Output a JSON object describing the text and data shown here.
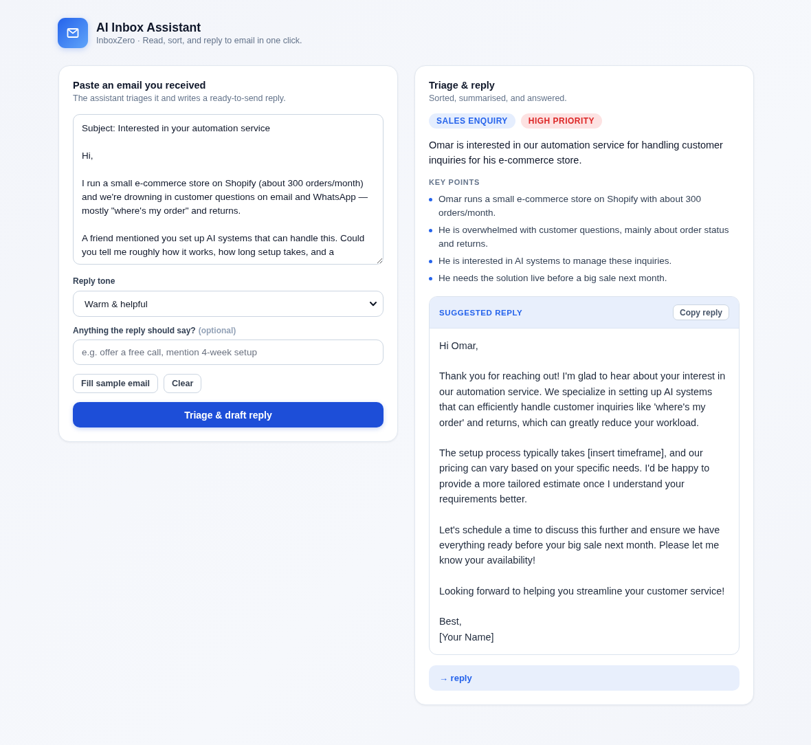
{
  "header": {
    "title": "AI Inbox Assistant",
    "subtitle": "InboxZero · Read, sort, and reply to email in one click."
  },
  "input_panel": {
    "title": "Paste an email you received",
    "subtitle": "The assistant triages it and writes a ready-to-send reply.",
    "email_text": "Subject: Interested in your automation service\n\nHi,\n\nI run a small e-commerce store on Shopify (about 300 orders/month) and we're drowning in customer questions on email and WhatsApp — mostly \"where's my order\" and returns.\n\nA friend mentioned you set up AI systems that can handle this. Could you tell me roughly how it works, how long setup takes, and a",
    "tone": {
      "label": "Reply tone",
      "value": "Warm & helpful"
    },
    "notes": {
      "label": "Anything the reply should say?",
      "hint": "(optional)",
      "placeholder": "e.g. offer a free call, mention 4-week setup"
    },
    "buttons": [
      "Fill sample email",
      "Clear"
    ],
    "submit": "Triage & draft reply"
  },
  "result_panel": {
    "title": "Triage & reply",
    "subtitle": "Sorted, summarised, and answered.",
    "badges": [
      {
        "label": "SALES ENQUIRY",
        "kind": "category"
      },
      {
        "label": "HIGH PRIORITY",
        "kind": "priority"
      }
    ],
    "summary": "Omar is interested in our automation service for handling customer inquiries for his e-commerce store.",
    "key_points_heading": "KEY POINTS",
    "key_points": [
      "Omar runs a small e-commerce store on Shopify with about 300 orders/month.",
      "He is overwhelmed with customer questions, mainly about order status and returns.",
      "He is interested in AI systems to manage these inquiries.",
      "He needs the solution live before a big sale next month."
    ],
    "suggested_reply": {
      "heading": "SUGGESTED REPLY",
      "copy_button": "Copy reply",
      "paragraphs": [
        "Hi Omar,",
        "Thank you for reaching out! I'm glad to hear about your interest in our automation service. We specialize in setting up AI systems that can efficiently handle customer inquiries like 'where's my order' and returns, which can greatly reduce your workload.",
        "The setup process typically takes [insert timeframe], and our pricing can vary based on your specific needs. I'd be happy to provide a more tailored estimate once I understand your requirements better.",
        "Let's schedule a time to discuss this further and ensure we have everything ready before your big sale next month. Please let me know your availability!",
        "Looking forward to helping you streamline your customer service!",
        "Best,\n[Your Name]"
      ]
    },
    "reply_link": "→ reply"
  }
}
